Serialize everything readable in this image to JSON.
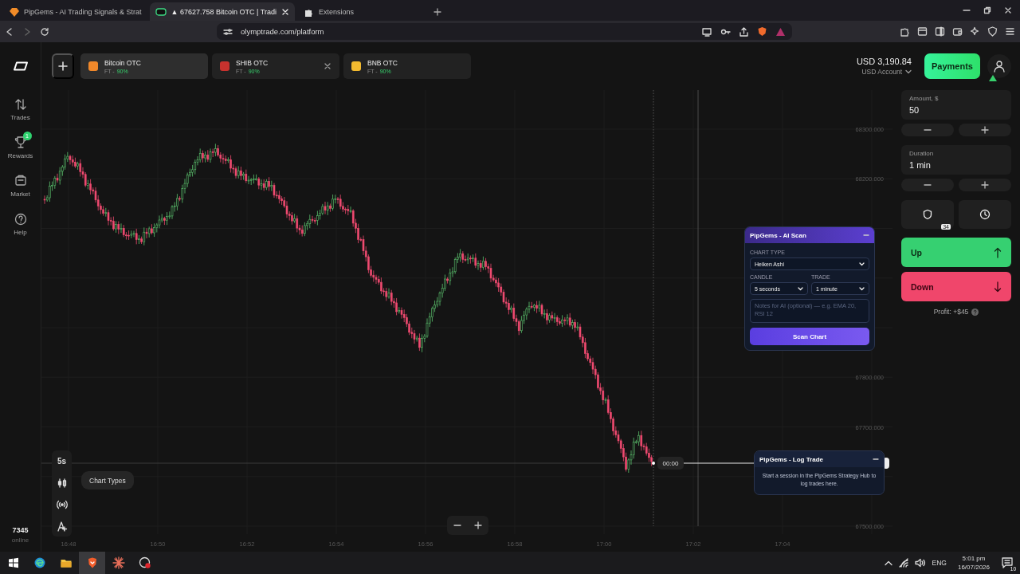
{
  "browser": {
    "tabs": [
      {
        "title": "PipGems - AI Trading Signals & Strat",
        "kind": "pipgems",
        "selected": false
      },
      {
        "title": "▲ 67627.758 Bitcoin OTC | Tradi",
        "kind": "platform",
        "selected": true
      },
      {
        "title": "Extensions",
        "kind": "extensions",
        "selected": false
      }
    ],
    "url": "olymptrade.com/platform"
  },
  "nav": {
    "items": [
      {
        "label": "Trades",
        "kind": "trades"
      },
      {
        "label": "Rewards",
        "kind": "rewards",
        "badge": "1"
      },
      {
        "label": "Market",
        "kind": "market"
      },
      {
        "label": "Help",
        "kind": "help"
      }
    ],
    "online_count": "7345",
    "online_label": "online"
  },
  "assets": [
    {
      "name": "Bitcoin OTC",
      "mode": "FT -",
      "payout": "90%",
      "color": "#f0882a",
      "selected": true,
      "closable": false
    },
    {
      "name": "SHIB OTC",
      "mode": "FT -",
      "payout": "90%",
      "color": "#c8322e",
      "selected": false,
      "closable": true
    },
    {
      "name": "BNB OTC",
      "mode": "FT -",
      "payout": "90%",
      "color": "#f3ba2f",
      "selected": false,
      "closable": false
    }
  ],
  "account": {
    "balance": "USD 3,190.84",
    "label": "USD Account"
  },
  "payments": "Payments",
  "trade_panel": {
    "amount_label": "Amount, $",
    "amount": "50",
    "duration_label": "Duration",
    "duration": "1 min",
    "protect_badge": "34",
    "up": "Up",
    "down": "Down",
    "profit": "Profit: +$45"
  },
  "tools": {
    "interval": "5s",
    "tooltip": "Chart Types"
  },
  "chart": {
    "y_labels": [
      "68300.000",
      "68200.000",
      "67800.000",
      "67700.000",
      "67500.000"
    ],
    "x_labels": [
      "16:48",
      "16:50",
      "16:52",
      "16:54",
      "16:56",
      "16:58",
      "17:00",
      "17:02",
      "17:04"
    ],
    "timer": "00:00"
  },
  "ai_scan": {
    "title": "PipGems - AI Scan",
    "chart_type_label": "CHART TYPE",
    "chart_type": "Heiken Ashi",
    "candle_label": "CANDLE",
    "candle": "5 seconds",
    "trade_label": "TRADE",
    "trade": "1 minute",
    "notes_placeholder": "Notes for AI (optional) — e.g. EMA 20, RSI 12",
    "button": "Scan Chart"
  },
  "log_trade": {
    "title": "PipGems - Log Trade",
    "message": "Start a session in the PipGems Strategy Hub to log trades here."
  },
  "taskbar": {
    "apps": [
      {
        "kind": "edge",
        "selected": false
      },
      {
        "kind": "files",
        "selected": false
      },
      {
        "kind": "brave",
        "selected": true
      },
      {
        "kind": "spark",
        "selected": false
      },
      {
        "kind": "obs",
        "selected": false
      }
    ],
    "language": "ENG",
    "time": "5:01 pm",
    "date": "16/07/2026",
    "notifications": "10"
  }
}
